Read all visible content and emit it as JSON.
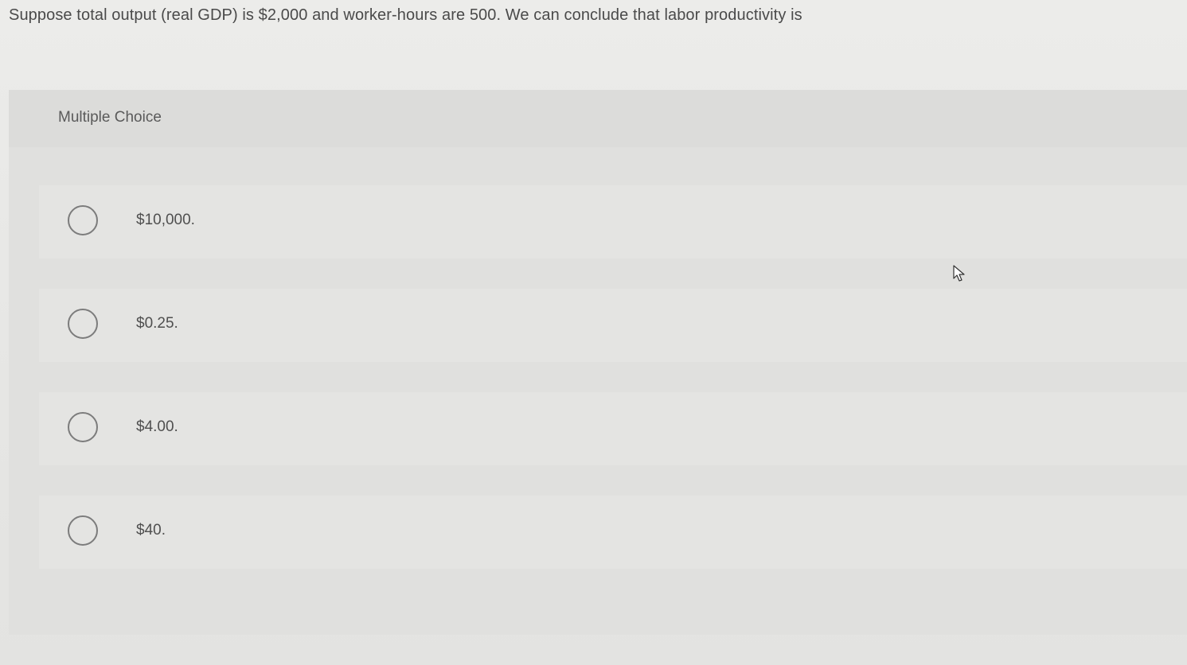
{
  "question": {
    "text": "Suppose total output (real GDP) is $2,000 and worker-hours are 500. We can conclude that labor productivity is"
  },
  "panel": {
    "title": "Multiple Choice",
    "options": [
      {
        "label": "$10,000."
      },
      {
        "label": "$0.25."
      },
      {
        "label": "$4.00."
      },
      {
        "label": "$40."
      }
    ]
  },
  "icons": {
    "radio": "radio-unchecked-icon",
    "cursor": "mouse-pointer-icon"
  }
}
